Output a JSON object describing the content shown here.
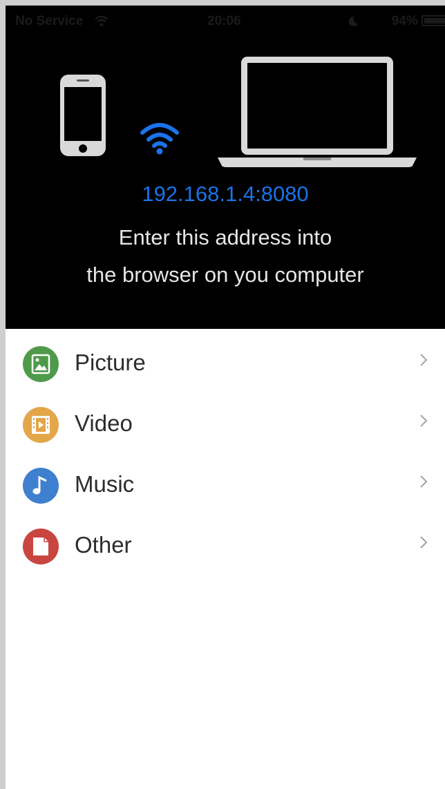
{
  "status_bar": {
    "carrier": "No Service",
    "time": "20:06",
    "battery": "94%"
  },
  "connection": {
    "address": "192.168.1.4:8080",
    "instruction_line1": "Enter this address into",
    "instruction_line2": "the browser on you computer",
    "accent_color": "#1a73e8"
  },
  "categories": [
    {
      "label": "Picture",
      "icon": "picture-icon",
      "color": "#4f9a4a"
    },
    {
      "label": "Video",
      "icon": "film-icon",
      "color": "#e3a64a"
    },
    {
      "label": "Music",
      "icon": "music-note-icon",
      "color": "#3f7fcf"
    },
    {
      "label": "Other",
      "icon": "document-icon",
      "color": "#c9453f"
    }
  ]
}
